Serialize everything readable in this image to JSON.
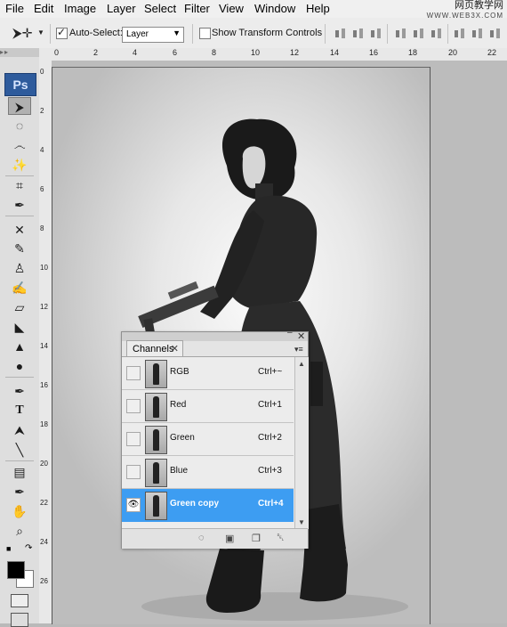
{
  "menu": [
    "File",
    "Edit",
    "Image",
    "Layer",
    "Select",
    "Filter",
    "View",
    "Window",
    "Help"
  ],
  "watermark": {
    "line1": "网页教学网",
    "line2": "WWW.WEB3X.COM"
  },
  "options": {
    "auto_select_label": "Auto-Select:",
    "auto_select_checked": true,
    "layer_select_value": "Layer",
    "show_transform_label": "Show Transform Controls",
    "show_transform_checked": false
  },
  "ruler_h": [
    "0",
    "2",
    "4",
    "6",
    "8",
    "10",
    "12",
    "14",
    "16",
    "18",
    "20",
    "22"
  ],
  "ruler_v": [
    "0",
    "2",
    "4",
    "6",
    "8",
    "10",
    "12",
    "14",
    "16",
    "18",
    "20",
    "22",
    "24",
    "26"
  ],
  "toolbox": {
    "logo": "Ps"
  },
  "channels_panel": {
    "tab": "Channels",
    "rows": [
      {
        "name": "RGB",
        "shortcut": "Ctrl+~",
        "visible": false,
        "selected": false
      },
      {
        "name": "Red",
        "shortcut": "Ctrl+1",
        "visible": false,
        "selected": false
      },
      {
        "name": "Green",
        "shortcut": "Ctrl+2",
        "visible": false,
        "selected": false
      },
      {
        "name": "Blue",
        "shortcut": "Ctrl+3",
        "visible": false,
        "selected": false
      },
      {
        "name": "Green copy",
        "shortcut": "Ctrl+4",
        "visible": true,
        "selected": true
      }
    ]
  },
  "colors": {
    "selection": "#3d9df2",
    "menubar": "#f0f0f0",
    "ps_logo": "#2e5b9c"
  },
  "icons": {
    "eye": "eye-icon",
    "panel_buttons": [
      "load-channel-selection-icon",
      "save-selection-icon",
      "new-channel-icon",
      "delete-channel-icon"
    ]
  }
}
